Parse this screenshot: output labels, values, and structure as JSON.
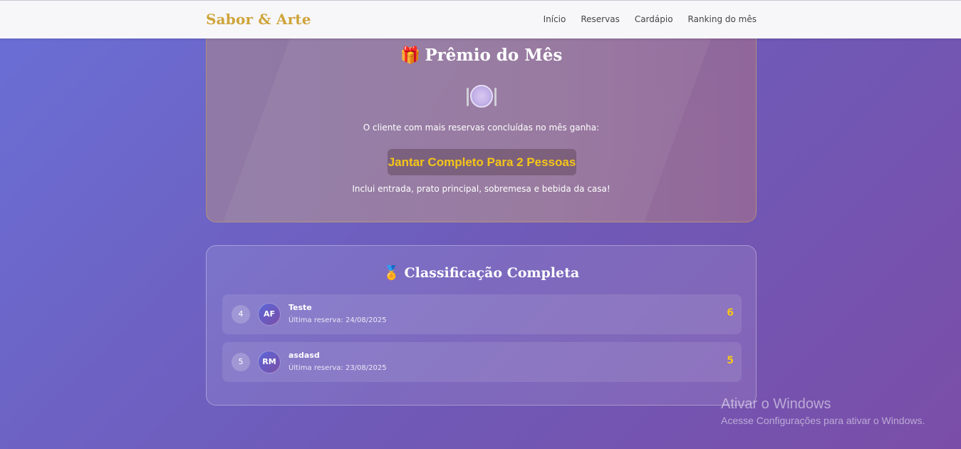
{
  "navbar": {
    "brand": "Sabor & Arte",
    "links": [
      "Início",
      "Reservas",
      "Cardápio",
      "Ranking do mês"
    ]
  },
  "prize": {
    "gift_icon": "🎁",
    "title": "Prêmio do Mês",
    "plate_icon": "plate-with-cutlery",
    "description": "O cliente com mais reservas concluídas no mês ganha:",
    "badge": "Jantar Completo Para 2 Pessoas",
    "note": "Inclui entrada, prato principal, sobremesa e bebida da casa!"
  },
  "ranking": {
    "medal_icon": "🏅",
    "title": "Classificação Completa",
    "rows": [
      {
        "position": "4",
        "initials": "AF",
        "name": "Teste",
        "last_reservation": "Última reserva: 24/08/2025",
        "score": "6"
      },
      {
        "position": "5",
        "initials": "RM",
        "name": "asdasd",
        "last_reservation": "Última reserva: 23/08/2025",
        "score": "5"
      }
    ]
  },
  "watermark": {
    "title": "Ativar o Windows",
    "subtitle": "Acesse Configurações para ativar o Windows."
  },
  "colors": {
    "brand": "#cfa43a",
    "accent_gold": "#f5c518",
    "background_start": "#6a6fd6",
    "background_end": "#7a4ea8"
  }
}
